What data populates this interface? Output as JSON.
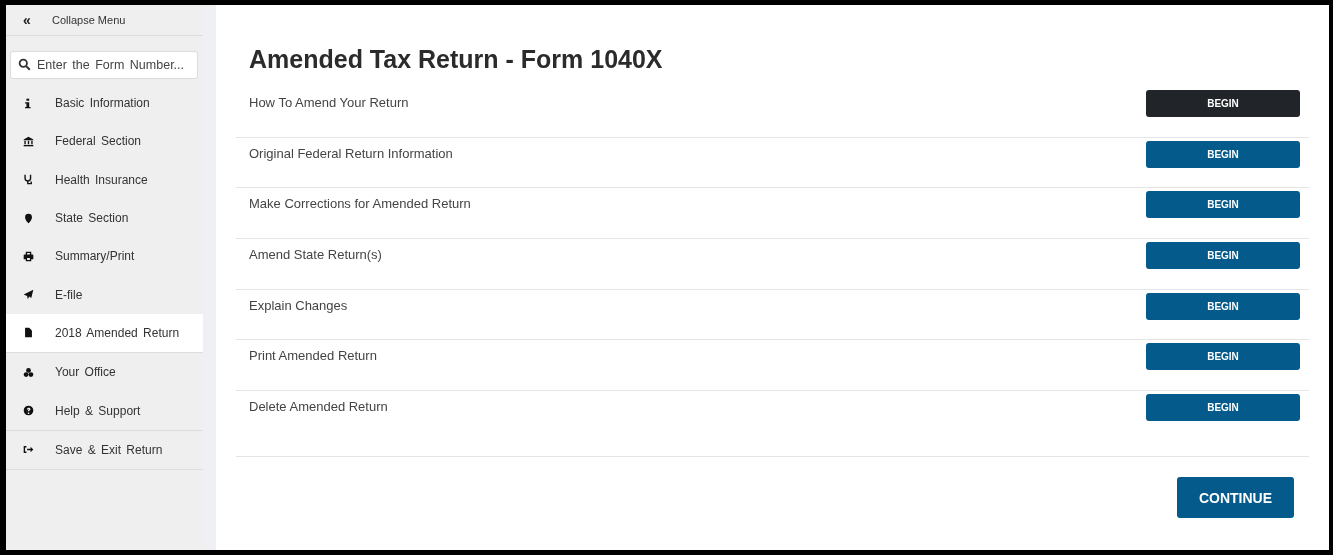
{
  "sidebar": {
    "collapse": {
      "icon": "«",
      "label": "Collapse Menu"
    },
    "search": {
      "placeholder": "Enter the Form Number..."
    },
    "groups": [
      {
        "items": [
          {
            "label": "Basic Information",
            "selected": false
          },
          {
            "label": "Federal Section",
            "selected": false
          },
          {
            "label": "Health Insurance",
            "selected": false
          },
          {
            "label": "State Section",
            "selected": false
          },
          {
            "label": "Summary/Print",
            "selected": false
          },
          {
            "label": "E-file",
            "selected": false
          },
          {
            "label": "2018 Amended Return",
            "selected": true
          }
        ]
      },
      {
        "items": [
          {
            "label": "Your Office",
            "selected": false
          },
          {
            "label": "Help & Support",
            "selected": false
          }
        ]
      },
      {
        "items": [
          {
            "label": "Save & Exit Return",
            "selected": false
          }
        ]
      }
    ]
  },
  "main": {
    "title": "Amended Tax Return - Form 1040X",
    "sections": [
      {
        "label": "How To Amend Your Return",
        "button": "BEGIN",
        "selected": true
      },
      {
        "label": "Original Federal Return Information",
        "button": "BEGIN",
        "selected": false
      },
      {
        "label": "Make Corrections for Amended Return",
        "button": "BEGIN",
        "selected": false
      },
      {
        "label": "Amend State Return(s)",
        "button": "BEGIN",
        "selected": false
      },
      {
        "label": "Explain Changes",
        "button": "BEGIN",
        "selected": false
      },
      {
        "label": "Print Amended Return",
        "button": "BEGIN",
        "selected": false
      },
      {
        "label": "Delete Amended Return",
        "button": "BEGIN",
        "selected": false
      }
    ],
    "continue_button": "CONTINUE"
  }
}
